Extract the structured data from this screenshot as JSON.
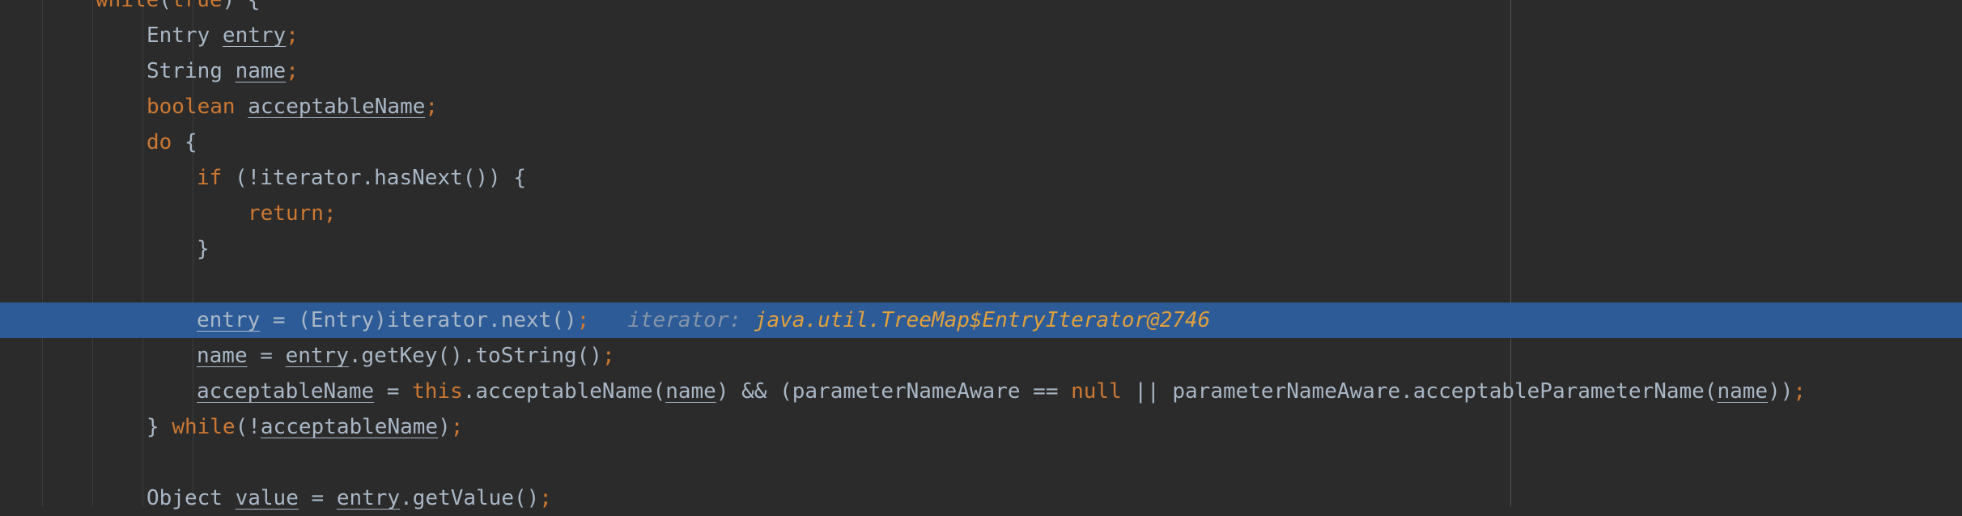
{
  "editor": {
    "lines": [
      {
        "id": "while",
        "tokens": [
          {
            "t": "while",
            "c": "kw"
          },
          {
            "t": "(",
            "c": "tx"
          },
          {
            "t": "true",
            "c": "kw"
          },
          {
            "t": ") {",
            "c": "tx"
          }
        ]
      },
      {
        "id": "decl-entry",
        "tokens": [
          {
            "t": "Entry ",
            "c": "tx"
          },
          {
            "t": "entry",
            "c": "ul"
          },
          {
            "t": ";",
            "c": "pn"
          }
        ]
      },
      {
        "id": "decl-name",
        "tokens": [
          {
            "t": "String ",
            "c": "tx"
          },
          {
            "t": "name",
            "c": "ul"
          },
          {
            "t": ";",
            "c": "pn"
          }
        ]
      },
      {
        "id": "decl-acceptable",
        "tokens": [
          {
            "t": "boolean ",
            "c": "kw"
          },
          {
            "t": "acceptableName",
            "c": "ul"
          },
          {
            "t": ";",
            "c": "pn"
          }
        ]
      },
      {
        "id": "do",
        "tokens": [
          {
            "t": "do ",
            "c": "kw"
          },
          {
            "t": "{",
            "c": "tx"
          }
        ]
      },
      {
        "id": "if",
        "tokens": [
          {
            "t": "if ",
            "c": "kw"
          },
          {
            "t": "(!iterator.hasNext()) {",
            "c": "tx"
          }
        ]
      },
      {
        "id": "return",
        "tokens": [
          {
            "t": "return;",
            "c": "kw"
          }
        ]
      },
      {
        "id": "close-if",
        "tokens": [
          {
            "t": "}",
            "c": "tx"
          }
        ]
      },
      {
        "id": "blank-1",
        "tokens": []
      },
      {
        "id": "assign-entry",
        "highlighted": true,
        "tokens": [
          {
            "t": "entry",
            "c": "ul"
          },
          {
            "t": " = (Entry)iterator.next()",
            "c": "tx"
          },
          {
            "t": ";",
            "c": "pn"
          },
          {
            "t": "   ",
            "c": "tx"
          },
          {
            "t": "iterator: ",
            "c": "hint-label"
          },
          {
            "t": "java.util.TreeMap$EntryIterator@2746",
            "c": "hint-val"
          }
        ]
      },
      {
        "id": "assign-name",
        "tokens": [
          {
            "t": "name",
            "c": "ul"
          },
          {
            "t": " = ",
            "c": "tx"
          },
          {
            "t": "entry",
            "c": "ul"
          },
          {
            "t": ".getKey().toString()",
            "c": "tx"
          },
          {
            "t": ";",
            "c": "pn"
          }
        ]
      },
      {
        "id": "assign-acceptable",
        "tokens": [
          {
            "t": "acceptableName",
            "c": "ul"
          },
          {
            "t": " = ",
            "c": "tx"
          },
          {
            "t": "this",
            "c": "kw"
          },
          {
            "t": ".acceptableName(",
            "c": "tx"
          },
          {
            "t": "name",
            "c": "ul"
          },
          {
            "t": ") && (parameterNameAware == ",
            "c": "tx"
          },
          {
            "t": "null",
            "c": "kw"
          },
          {
            "t": " || parameterNameAware.acceptableParameterName(",
            "c": "tx"
          },
          {
            "t": "name",
            "c": "ul"
          },
          {
            "t": "))",
            "c": "tx"
          },
          {
            "t": ";",
            "c": "pn"
          }
        ]
      },
      {
        "id": "while-cond",
        "tokens": [
          {
            "t": "} ",
            "c": "tx"
          },
          {
            "t": "while",
            "c": "kw"
          },
          {
            "t": "(!",
            "c": "tx"
          },
          {
            "t": "acceptableName",
            "c": "ul"
          },
          {
            "t": ")",
            "c": "tx"
          },
          {
            "t": ";",
            "c": "pn"
          }
        ]
      },
      {
        "id": "blank-2",
        "tokens": []
      },
      {
        "id": "get-value",
        "tokens": [
          {
            "t": "Object ",
            "c": "tx"
          },
          {
            "t": "value",
            "c": "ul"
          },
          {
            "t": " = ",
            "c": "tx"
          },
          {
            "t": "entry",
            "c": "ul"
          },
          {
            "t": ".getValue()",
            "c": "tx"
          },
          {
            "t": ";",
            "c": "pn"
          }
        ]
      }
    ]
  }
}
